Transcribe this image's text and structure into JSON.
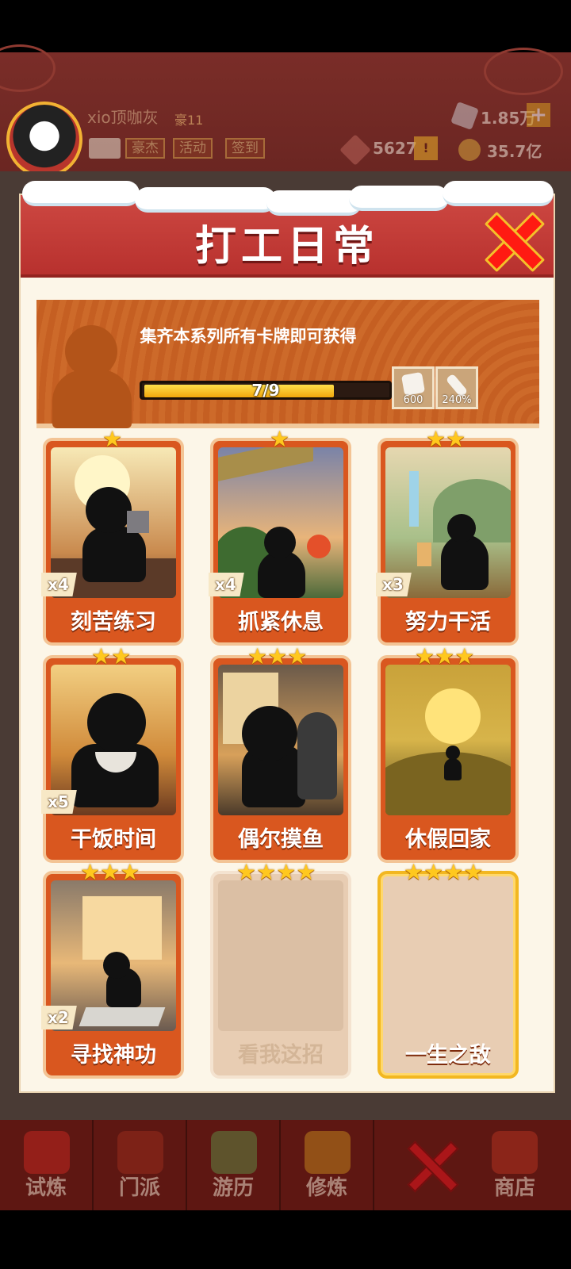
{
  "header": {
    "username": "xio顶咖灰",
    "level": "豪11",
    "buttons": [
      "豪杰",
      "活动",
      "签到"
    ],
    "gems": "1.85万",
    "resource_a": "5627",
    "coins": "35.7亿",
    "alert": "!",
    "plus": "+"
  },
  "dialog": {
    "title": "打工日常",
    "banner_text": "集齐本系列所有卡牌即可获得",
    "progress_text": "7/9",
    "progress_fraction": 0.78,
    "rewards": [
      {
        "icon": "dice-icon",
        "value": "600"
      },
      {
        "icon": "sword-icon",
        "value": "240%"
      }
    ]
  },
  "cards": [
    {
      "name": "刻苦练习",
      "stars": 1,
      "count": "x4",
      "locked": false
    },
    {
      "name": "抓紧休息",
      "stars": 1,
      "count": "x4",
      "locked": false
    },
    {
      "name": "努力干活",
      "stars": 2,
      "count": "x3",
      "locked": false
    },
    {
      "name": "干饭时间",
      "stars": 2,
      "count": "x5",
      "locked": false
    },
    {
      "name": "偶尔摸鱼",
      "stars": 3,
      "count": "",
      "locked": false
    },
    {
      "name": "休假回家",
      "stars": 3,
      "count": "",
      "locked": false
    },
    {
      "name": "寻找神功",
      "stars": 3,
      "count": "x2",
      "locked": false
    },
    {
      "name": "看我这招",
      "stars": 4,
      "count": "",
      "locked": true
    },
    {
      "name": "一生之敌",
      "stars": 4,
      "count": "",
      "locked": true
    }
  ],
  "bottom_nav": [
    {
      "label": "试炼",
      "icon": "firecracker-icon"
    },
    {
      "label": "门派",
      "icon": "temple-icon"
    },
    {
      "label": "游历",
      "icon": "mountain-icon"
    },
    {
      "label": "修炼",
      "icon": "book-icon"
    },
    {
      "label": "",
      "icon": "close-icon"
    },
    {
      "label": "商店",
      "icon": "shop-icon"
    }
  ],
  "colors": {
    "header_red": "#c23b36",
    "card_orange": "#d9571f",
    "star_gold": "#ffc81e",
    "progress_yellow": "#f6c22a"
  }
}
